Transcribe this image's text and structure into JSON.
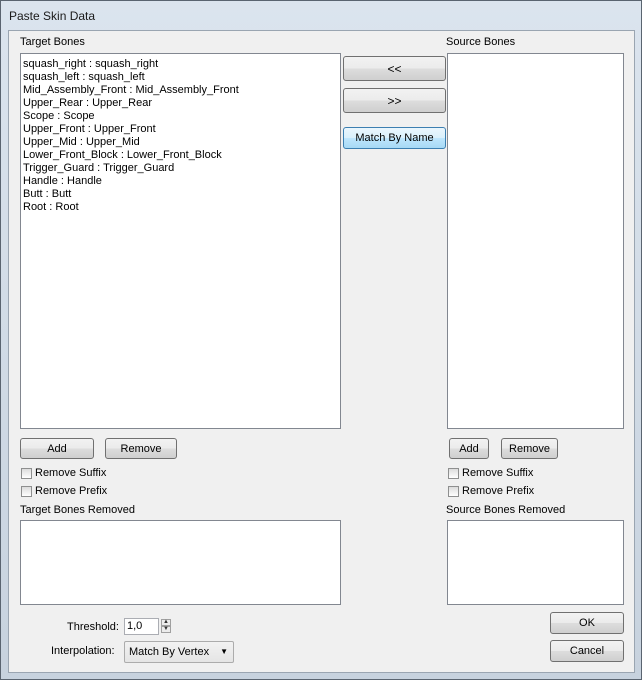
{
  "window": {
    "title": "Paste Skin Data"
  },
  "target": {
    "label": "Target Bones",
    "bones": [
      "squash_right : squash_right",
      "squash_left : squash_left",
      "Mid_Assembly_Front : Mid_Assembly_Front",
      "Upper_Rear : Upper_Rear",
      "Scope : Scope",
      "Upper_Front : Upper_Front",
      "Upper_Mid : Upper_Mid",
      "Lower_Front_Block : Lower_Front_Block",
      "Trigger_Guard : Trigger_Guard",
      "Handle : Handle",
      "Butt : Butt",
      "Root : Root"
    ],
    "add_label": "Add",
    "remove_label": "Remove",
    "remove_suffix_label": "Remove Suffix",
    "remove_prefix_label": "Remove Prefix",
    "removed_label": "Target Bones Removed"
  },
  "source": {
    "label": "Source Bones",
    "bones": [],
    "add_label": "Add",
    "remove_label": "Remove",
    "remove_suffix_label": "Remove Suffix",
    "remove_prefix_label": "Remove Prefix",
    "removed_label": "Source Bones Removed"
  },
  "middle": {
    "move_left_label": "<<",
    "move_right_label": ">>",
    "match_by_name_label": "Match By Name"
  },
  "options": {
    "threshold_label": "Threshold:",
    "threshold_value": "1,0",
    "interpolation_label": "Interpolation:",
    "interpolation_value": "Match By Vertex"
  },
  "dialog": {
    "ok_label": "OK",
    "cancel_label": "Cancel"
  }
}
